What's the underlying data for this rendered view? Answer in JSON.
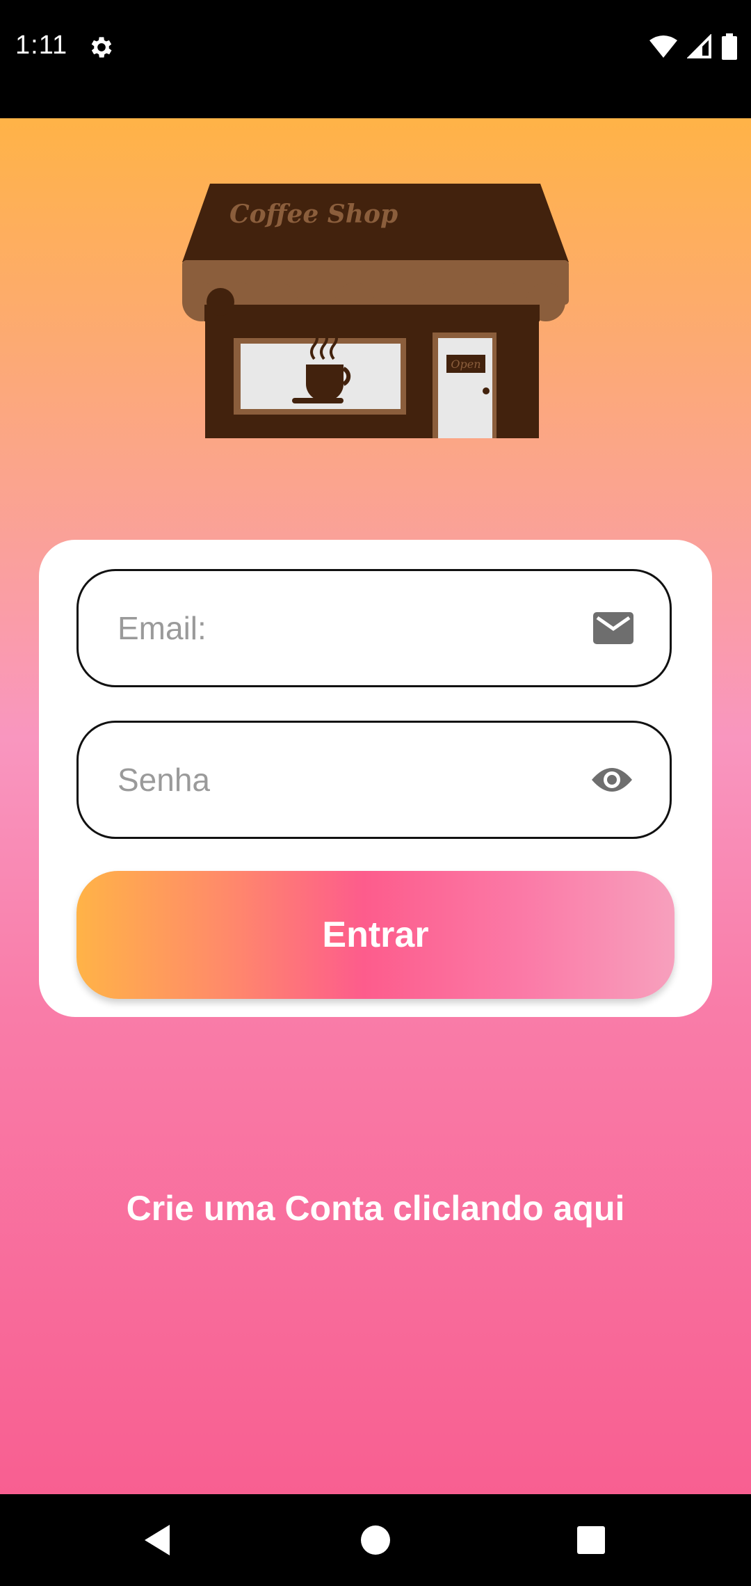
{
  "status_bar": {
    "time": "1:11",
    "icons": [
      "gear-icon",
      "wifi-icon",
      "signal-icon",
      "battery-icon"
    ]
  },
  "logo": {
    "sign_text": "Coffee Shop",
    "door_sign": "Open"
  },
  "login_form": {
    "email": {
      "placeholder": "Email:",
      "value": "",
      "icon": "email-icon"
    },
    "password": {
      "placeholder": "Senha",
      "value": "",
      "icon": "eye-icon"
    },
    "submit_label": "Entrar"
  },
  "signup_link": "Crie uma Conta cliclando aqui",
  "nav_bar": {
    "buttons": [
      "back-icon",
      "home-icon",
      "recents-icon"
    ]
  },
  "colors": {
    "gradient_top": "#ffb347",
    "gradient_bottom": "#f85f91",
    "button_pink": "#fd5c8c",
    "shop_brown": "#42220d",
    "awning_brown": "#8b5e3c"
  }
}
